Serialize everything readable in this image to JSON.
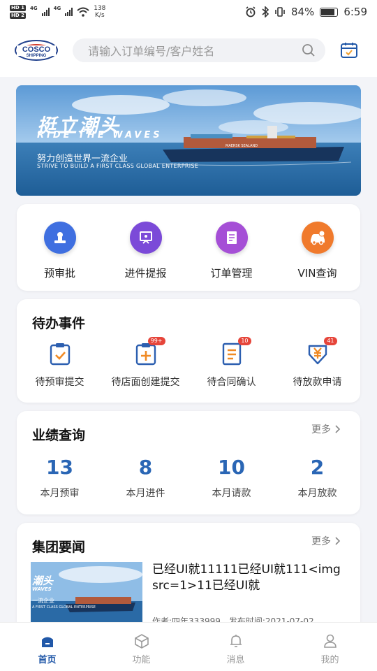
{
  "status_bar": {
    "sim1": "HD 1",
    "sim2": "HD 2",
    "net1": "4G",
    "net2": "4G",
    "speed_value": "138",
    "speed_unit": "K/s",
    "battery": "84%",
    "time": "6:59"
  },
  "header": {
    "logo_line1": "COSCO",
    "logo_line2": "SHIPPING",
    "search_placeholder": "请输入订单编号/客户姓名"
  },
  "banner": {
    "title_cn": "挺立潮头",
    "title_en": "RIDE THE WAVES",
    "slogan_cn": "努力创造世界一流企业",
    "slogan_en": "STRIVE TO BUILD A FIRST CLASS GLOBAL ENTERPRISE",
    "ship_name": "MAERSK SEALAND"
  },
  "quick_menu": [
    {
      "label": "预审批",
      "icon": "stamp-icon",
      "color": "#3f6fe0"
    },
    {
      "label": "进件提报",
      "icon": "board-icon",
      "color": "#7b4ad8"
    },
    {
      "label": "订单管理",
      "icon": "document-icon",
      "color": "#a54fd6"
    },
    {
      "label": "VIN查询",
      "icon": "car-icon",
      "color": "#f07a2c"
    }
  ],
  "todo": {
    "title": "待办事件",
    "items": [
      {
        "label": "待预审提交",
        "badge": "",
        "icon": "clipboard-check-icon"
      },
      {
        "label": "待店面创建提交",
        "badge": "99+",
        "icon": "clipboard-plus-icon"
      },
      {
        "label": "待合同确认",
        "badge": "10",
        "icon": "contract-icon"
      },
      {
        "label": "待放款申请",
        "badge": "41",
        "icon": "yuan-download-icon"
      }
    ]
  },
  "performance": {
    "title": "业绩查询",
    "more": "更多",
    "items": [
      {
        "value": "13",
        "label": "本月预审"
      },
      {
        "value": "8",
        "label": "本月进件"
      },
      {
        "value": "10",
        "label": "本月请款"
      },
      {
        "value": "2",
        "label": "本月放款"
      }
    ]
  },
  "news": {
    "title": "集团要闻",
    "more": "更多",
    "item_title": "已经UI就11111已经UI就111<img src=1>11已经UI就",
    "item_meta": "作者:四年333999　发布时间:2021-07-02",
    "thumb_title": "潮头",
    "thumb_en": "WAVES",
    "thumb_cn": "一流企业",
    "thumb_sub": "A FIRST CLASS GLOBAL ENTERPRISE"
  },
  "tabs": [
    {
      "label": "首页",
      "icon": "home-icon",
      "active": true
    },
    {
      "label": "功能",
      "icon": "cube-icon",
      "active": false
    },
    {
      "label": "消息",
      "icon": "bell-icon",
      "active": false
    },
    {
      "label": "我的",
      "icon": "user-icon",
      "active": false
    }
  ],
  "colors": {
    "accent": "#2158a8",
    "number": "#2a66b5",
    "badge": "#e6453a"
  }
}
